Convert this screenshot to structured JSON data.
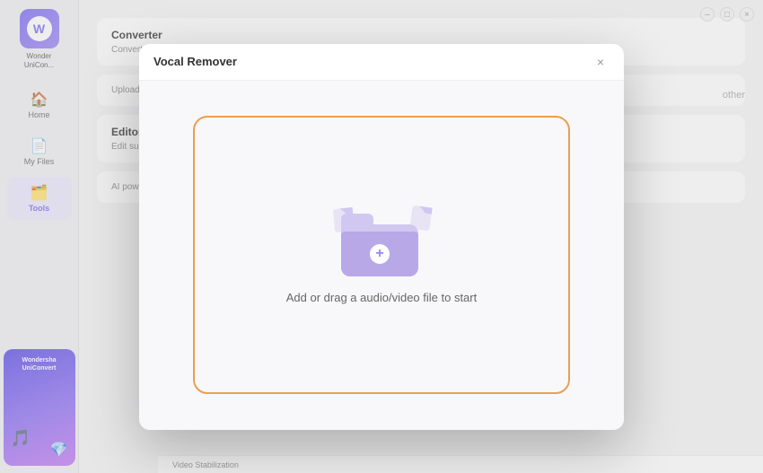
{
  "app": {
    "name": "WonderShare UniConverter",
    "name_short_line1": "Wonder",
    "name_short_line2": "UniCon..."
  },
  "sidebar": {
    "nav_items": [
      {
        "id": "home",
        "label": "Home",
        "icon": "🏠",
        "active": false
      },
      {
        "id": "my-files",
        "label": "My Files",
        "icon": "📁",
        "active": false
      },
      {
        "id": "tools",
        "label": "Tools",
        "icon": "🗂️",
        "active": true
      }
    ],
    "promo": {
      "title_line1": "Wondersha",
      "title_line2": "UniConvert"
    }
  },
  "background_cards": [
    {
      "id": "converter",
      "title": "Converter",
      "description": "Convert images to other formats"
    },
    {
      "id": "upload",
      "description": "Upload your files to"
    },
    {
      "id": "editor",
      "title": "Editor",
      "description": "Edit subtitle"
    },
    {
      "id": "ai",
      "description": "AI powered tools with AI."
    }
  ],
  "modal": {
    "title": "Vocal Remover",
    "close_button": "×",
    "drop_zone": {
      "text": "Add or drag a audio/video file to start"
    }
  },
  "window_controls": {
    "minimize": "–",
    "maximize": "□",
    "close": "×"
  },
  "bottom_nav": {
    "text": "Video Stabilization"
  },
  "other_label": "other"
}
